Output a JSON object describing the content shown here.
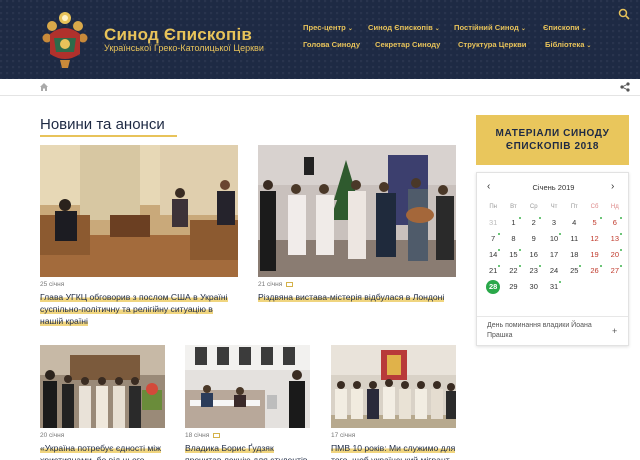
{
  "header": {
    "title": "Синод Єпископів",
    "subtitle": "Української Греко-Католицької Церкви",
    "nav_row1": [
      {
        "label": "Прес-центр",
        "has_menu": true
      },
      {
        "label": "Синод Єпископів",
        "has_menu": true
      },
      {
        "label": "Постійний Синод",
        "has_menu": true
      },
      {
        "label": "Єпископи",
        "has_menu": true
      }
    ],
    "nav_row2": [
      {
        "label": "Голова Синоду",
        "has_menu": false
      },
      {
        "label": "Секретар Синоду",
        "has_menu": false
      },
      {
        "label": "Структура Церкви",
        "has_menu": false
      },
      {
        "label": "Бібліотека",
        "has_menu": true
      }
    ],
    "accent_color": "#e8c35a",
    "background_color": "#1e2a44"
  },
  "main": {
    "section_title": "Новини та анонси",
    "news": [
      {
        "date": "25 січня",
        "title": "Глава УГКЦ обговорив з послом США в Україні суспільно-політичну та релігійну ситуацію в нашій країні",
        "has_photo_icon": false
      },
      {
        "date": "21 січня",
        "title": "Різдвяна вистава-містерія відбулася в Лондоні",
        "has_photo_icon": true
      },
      {
        "date": "20 січня",
        "title": "«Україна потребує єдності між християнами, бо від цього",
        "has_photo_icon": false
      },
      {
        "date": "18 січня",
        "title": "Владика Борис Ґудзяк прочитав лекцію для студентів",
        "has_photo_icon": true
      },
      {
        "date": "17 січня",
        "title": "ПМВ 10 років: Ми служимо для того, щоб український мігрант",
        "has_photo_icon": false
      }
    ]
  },
  "sidebar": {
    "banner_line1": "МАТЕРІАЛИ СИНОДУ",
    "banner_line2": "ЄПИСКОПІВ 2018",
    "calendar": {
      "prev": "‹",
      "next": "›",
      "month": "Січень 2019",
      "weekdays": [
        "Пн",
        "Вт",
        "Ср",
        "Чт",
        "Пт",
        "Сб",
        "Нд"
      ],
      "weeks": [
        [
          "31",
          "1",
          "2",
          "3",
          "4",
          "5",
          "6"
        ],
        [
          "7",
          "8",
          "9",
          "10",
          "11",
          "12",
          "13"
        ],
        [
          "14",
          "15",
          "16",
          "17",
          "18",
          "19",
          "20"
        ],
        [
          "21",
          "22",
          "23",
          "24",
          "25",
          "26",
          "27"
        ],
        [
          "28",
          "29",
          "30",
          "31",
          "",
          "",
          ""
        ]
      ],
      "today": "28",
      "event": "День поминання владики Йоана Прашка",
      "event_add": "+"
    }
  }
}
